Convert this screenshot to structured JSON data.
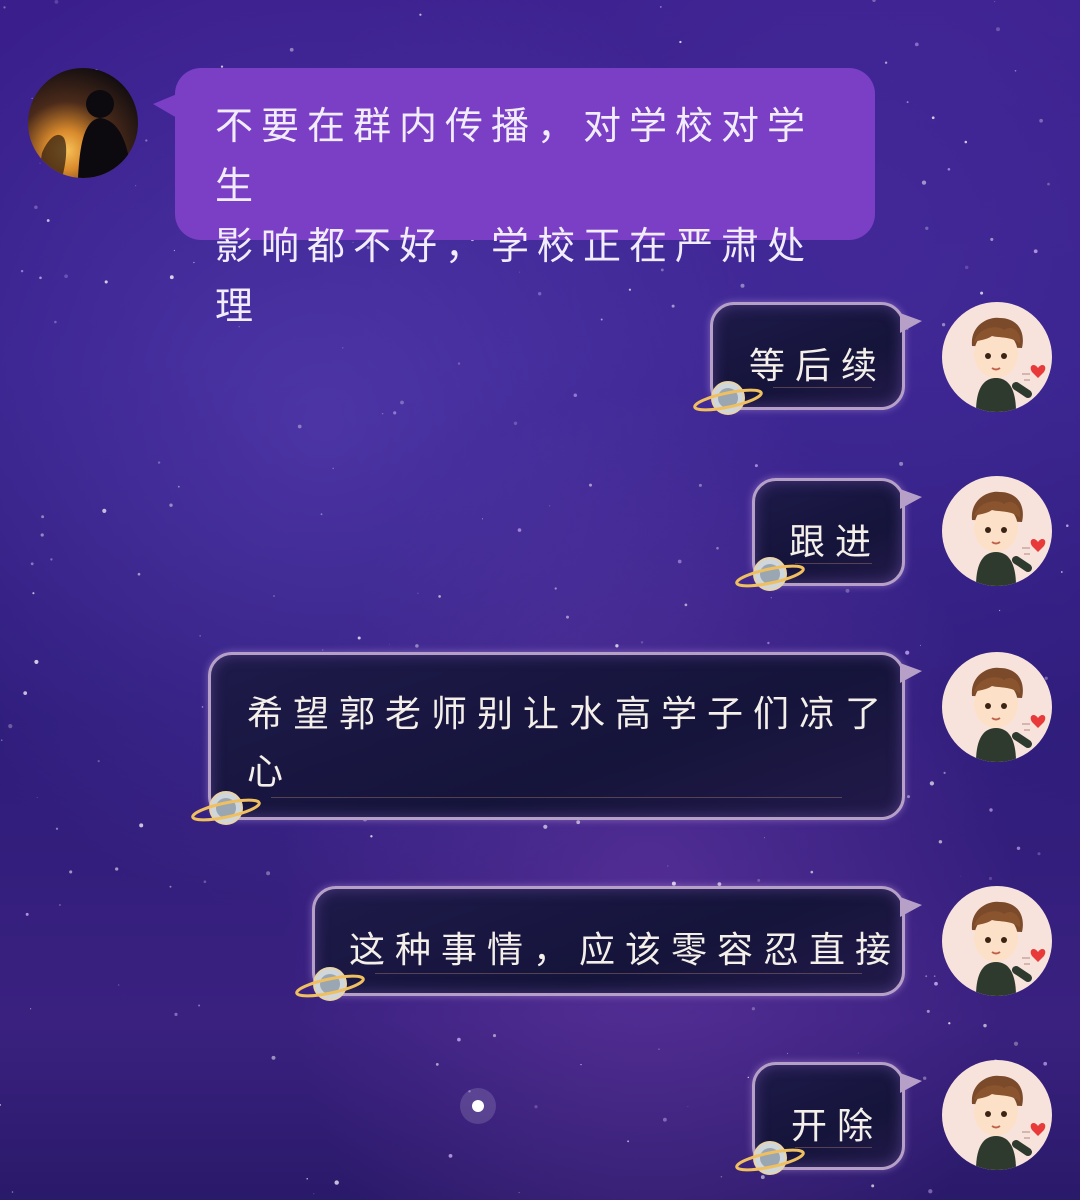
{
  "messages": [
    {
      "side": "left",
      "text_lines": [
        "不要在群内传播，对学校对学生",
        "影响都不好，学校正在严肃处理"
      ]
    },
    {
      "side": "right",
      "text": "等后续"
    },
    {
      "side": "right",
      "text": "跟进"
    },
    {
      "side": "right",
      "text_lines": [
        "希望郭老师别让水高学子们凉了",
        "心"
      ]
    },
    {
      "side": "right",
      "text": "这种事情，应该零容忍直接"
    },
    {
      "side": "right",
      "text": "开除"
    }
  ],
  "colors": {
    "background_top": "#3a1f8c",
    "left_bubble": "#7a3fc4",
    "right_bubble": "#1a1840",
    "right_bubble_border": "#b7a0c8",
    "text_light": "#f2ecff"
  },
  "icons": {
    "left_avatar": "avatar-sunset-silhouette",
    "right_avatar": "avatar-cartoon-boy-heart",
    "bubble_decoration": "planet-ring-icon"
  }
}
